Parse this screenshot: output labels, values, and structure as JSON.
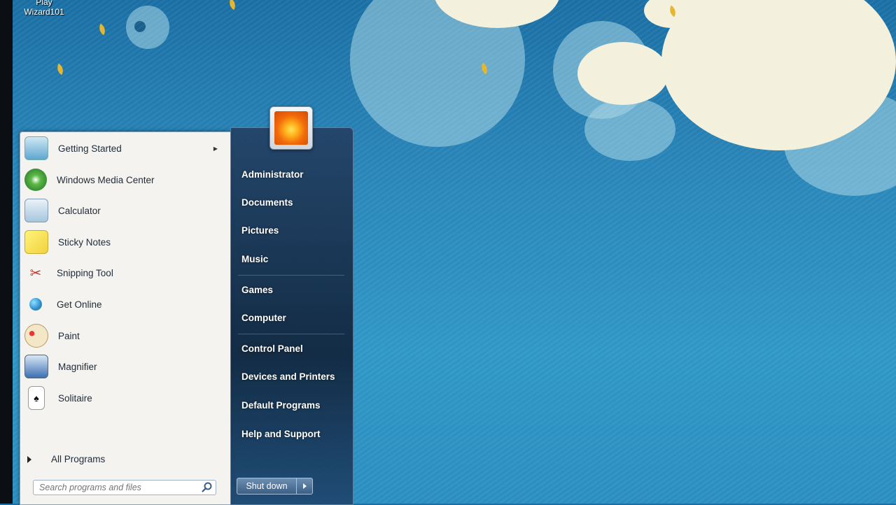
{
  "desktop": {
    "shortcut_label_line1": "Play",
    "shortcut_label_line2": "Wizard101"
  },
  "start_menu": {
    "programs": [
      {
        "label": "Getting Started",
        "icon": "getting-started-icon",
        "has_submenu": true
      },
      {
        "label": "Windows Media Center",
        "icon": "media-center-icon",
        "has_submenu": false
      },
      {
        "label": "Calculator",
        "icon": "calculator-icon",
        "has_submenu": false
      },
      {
        "label": "Sticky Notes",
        "icon": "sticky-notes-icon",
        "has_submenu": false
      },
      {
        "label": "Snipping Tool",
        "icon": "scissors-icon",
        "has_submenu": false
      },
      {
        "label": "Get Online",
        "icon": "globe-icon",
        "has_submenu": false
      },
      {
        "label": "Paint",
        "icon": "paint-palette-icon",
        "has_submenu": false
      },
      {
        "label": "Magnifier",
        "icon": "magnifier-icon",
        "has_submenu": false
      },
      {
        "label": "Solitaire",
        "icon": "playing-card-icon",
        "has_submenu": false
      }
    ],
    "all_programs_label": "All Programs",
    "search_placeholder": "Search programs and files",
    "places": [
      "Administrator",
      "Documents",
      "Pictures",
      "Music",
      "Games",
      "Computer",
      "Control Panel",
      "Devices and Printers",
      "Default Programs",
      "Help and Support"
    ],
    "shutdown_label": "Shut down"
  },
  "colors": {
    "desktop_blue": "#2a86b9",
    "menu_left_bg": "#f4f3ef",
    "menu_right_bg": "#1c3a5c"
  }
}
